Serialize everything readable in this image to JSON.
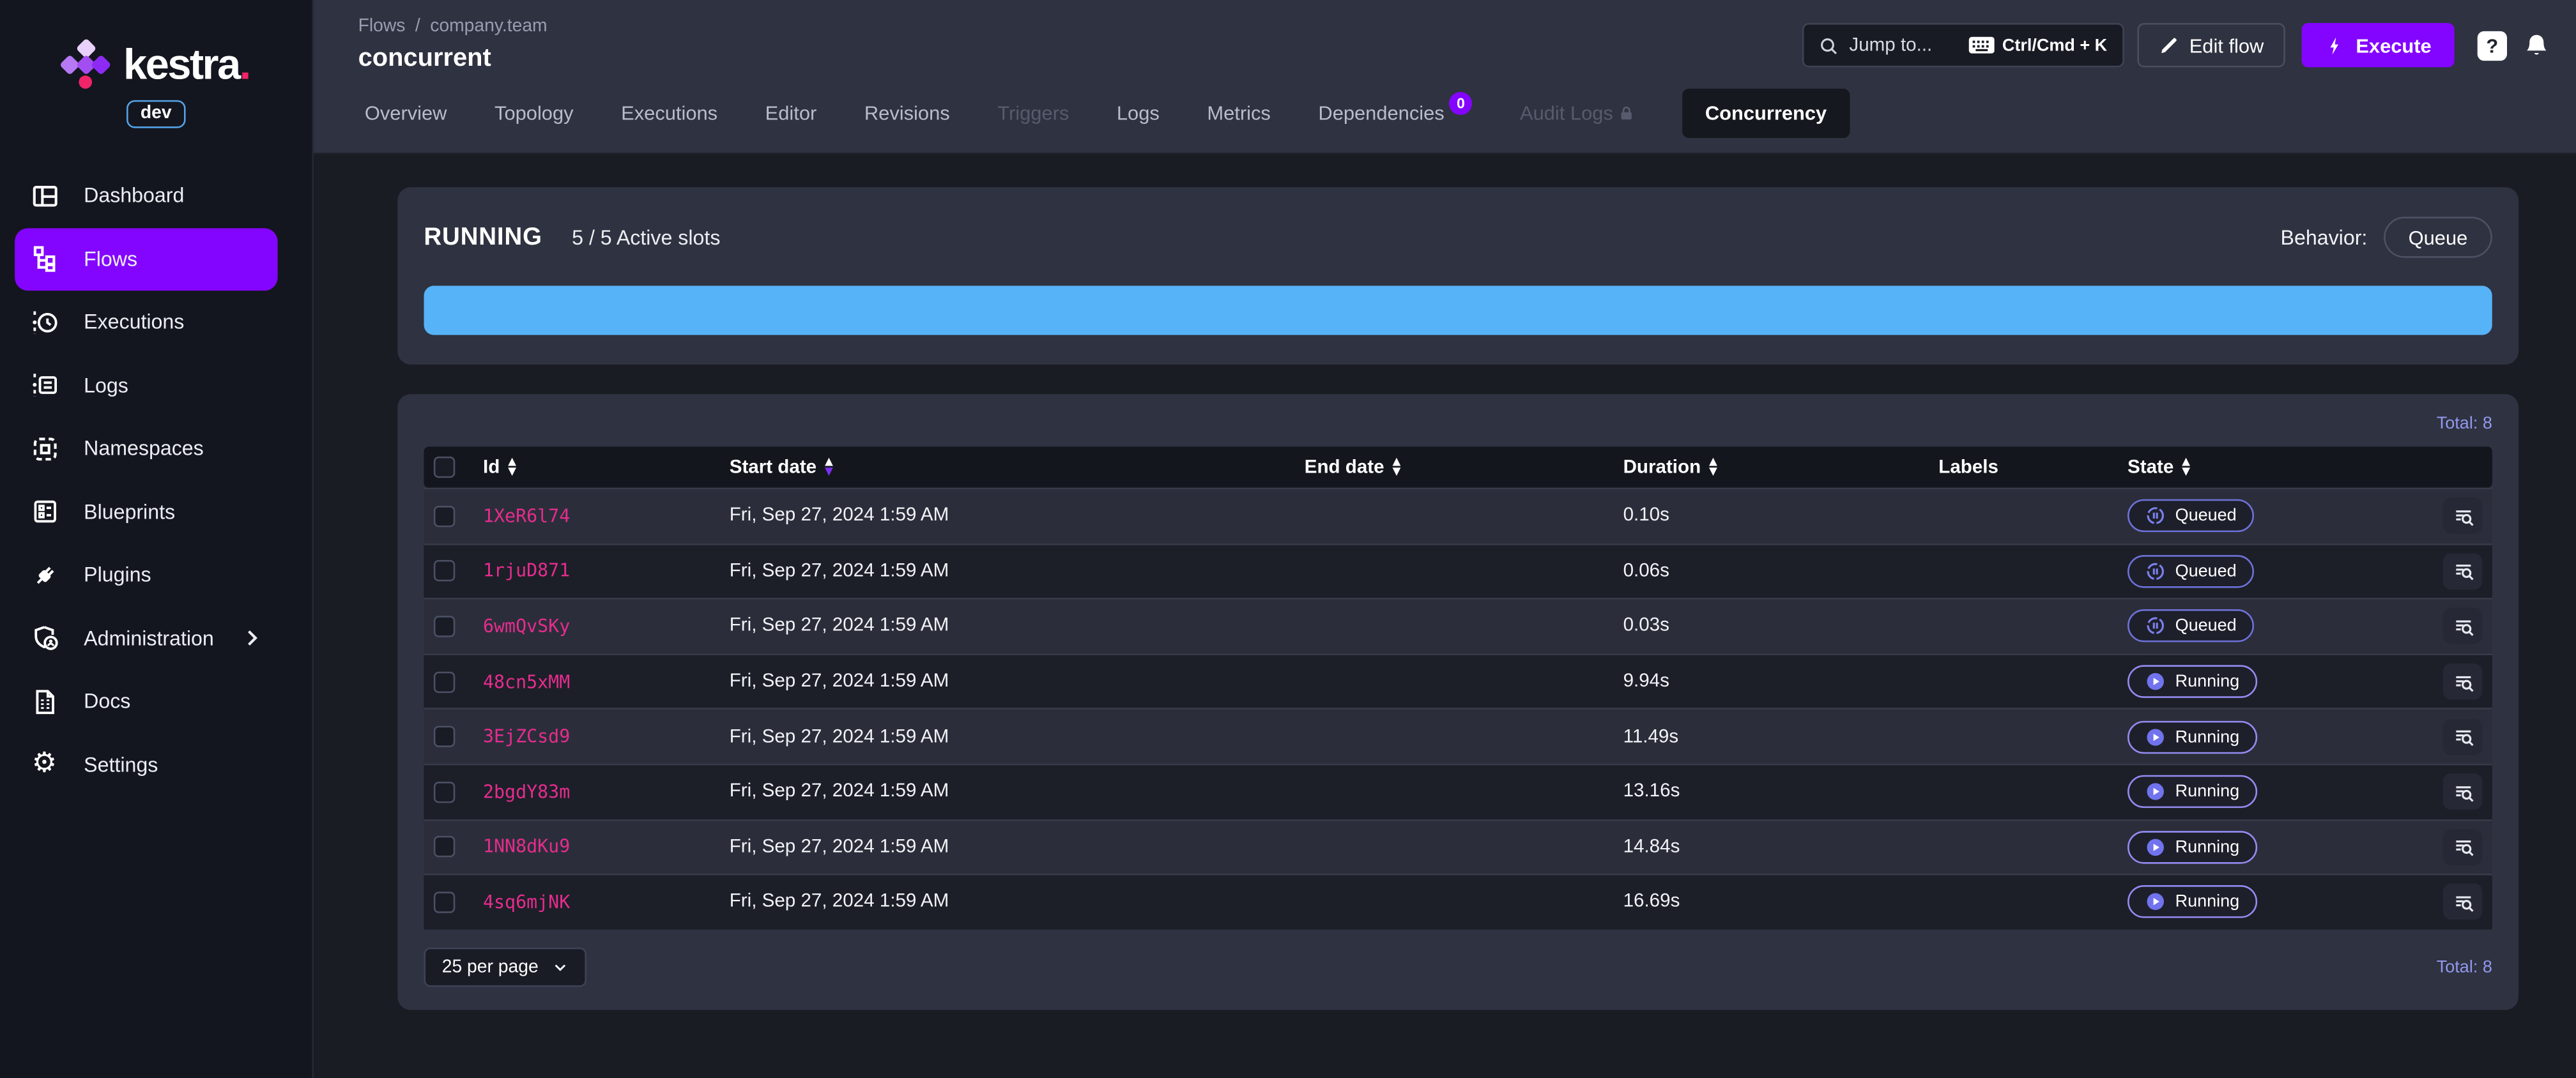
{
  "brand": {
    "name": "kestra",
    "env": "dev"
  },
  "breadcrumb": {
    "items": [
      "Flows",
      "company.team"
    ],
    "separator": "/"
  },
  "page": {
    "title": "concurrent"
  },
  "topbar": {
    "search": {
      "placeholder": "Jump to...",
      "shortcut": "Ctrl/Cmd + K"
    },
    "edit_flow_label": "Edit flow",
    "execute_label": "Execute",
    "help_label": "?"
  },
  "tabs": [
    {
      "label": "Overview"
    },
    {
      "label": "Topology"
    },
    {
      "label": "Executions"
    },
    {
      "label": "Editor"
    },
    {
      "label": "Revisions"
    },
    {
      "label": "Triggers",
      "disabled": true
    },
    {
      "label": "Logs"
    },
    {
      "label": "Metrics"
    },
    {
      "label": "Dependencies",
      "badge": "0"
    },
    {
      "label": "Audit Logs",
      "disabled": true,
      "lock": true
    },
    {
      "label": "Concurrency",
      "active": true
    }
  ],
  "sidebar": {
    "items": [
      {
        "label": "Dashboard",
        "icon": "dashboard-icon"
      },
      {
        "label": "Flows",
        "icon": "flows-icon",
        "active": true
      },
      {
        "label": "Executions",
        "icon": "executions-icon"
      },
      {
        "label": "Logs",
        "icon": "logs-icon"
      },
      {
        "label": "Namespaces",
        "icon": "namespaces-icon"
      },
      {
        "label": "Blueprints",
        "icon": "blueprints-icon"
      },
      {
        "label": "Plugins",
        "icon": "plugins-icon"
      },
      {
        "label": "Administration",
        "icon": "administration-icon",
        "chevron": true
      },
      {
        "label": "Docs",
        "icon": "docs-icon"
      },
      {
        "label": "Settings",
        "icon": "settings-icon"
      }
    ]
  },
  "concurrency": {
    "state_label": "RUNNING",
    "slots_label": "5 / 5 Active slots",
    "slots_active": 5,
    "slots_total": 5,
    "behavior_label": "Behavior:",
    "behavior_value": "Queue",
    "bar": {
      "fill_pct": 100,
      "color": "#57b3f8"
    }
  },
  "table": {
    "total_label": "Total: 8",
    "columns": [
      {
        "label": "Id",
        "sortable": true
      },
      {
        "label": "Start date",
        "sortable": true,
        "sorted": "desc"
      },
      {
        "label": "End date",
        "sortable": true
      },
      {
        "label": "Duration",
        "sortable": true
      },
      {
        "label": "Labels",
        "sortable": false
      },
      {
        "label": "State",
        "sortable": true
      }
    ],
    "rows": [
      {
        "id": "1XeR6l74",
        "start_date": "Fri, Sep 27, 2024 1:59 AM",
        "end_date": "",
        "duration": "0.10s",
        "labels": "",
        "state": "Queued"
      },
      {
        "id": "1rjuD871",
        "start_date": "Fri, Sep 27, 2024 1:59 AM",
        "end_date": "",
        "duration": "0.06s",
        "labels": "",
        "state": "Queued"
      },
      {
        "id": "6wmQvSKy",
        "start_date": "Fri, Sep 27, 2024 1:59 AM",
        "end_date": "",
        "duration": "0.03s",
        "labels": "",
        "state": "Queued"
      },
      {
        "id": "48cn5xMM",
        "start_date": "Fri, Sep 27, 2024 1:59 AM",
        "end_date": "",
        "duration": "9.94s",
        "labels": "",
        "state": "Running"
      },
      {
        "id": "3EjZCsd9",
        "start_date": "Fri, Sep 27, 2024 1:59 AM",
        "end_date": "",
        "duration": "11.49s",
        "labels": "",
        "state": "Running"
      },
      {
        "id": "2bgdY83m",
        "start_date": "Fri, Sep 27, 2024 1:59 AM",
        "end_date": "",
        "duration": "13.16s",
        "labels": "",
        "state": "Running"
      },
      {
        "id": "1NN8dKu9",
        "start_date": "Fri, Sep 27, 2024 1:59 AM",
        "end_date": "",
        "duration": "14.84s",
        "labels": "",
        "state": "Running"
      },
      {
        "id": "4sq6mjNK",
        "start_date": "Fri, Sep 27, 2024 1:59 AM",
        "end_date": "",
        "duration": "16.69s",
        "labels": "",
        "state": "Running"
      }
    ],
    "pagination": {
      "per_page": "25 per page",
      "total_label": "Total: 8"
    }
  },
  "colors": {
    "accent_purple": "#8405ff",
    "id_pink": "#e62c8e",
    "bar_blue": "#57b3f8",
    "total_periwinkle": "#9298ee",
    "state_border": "#7d81ef",
    "logo_pink": "#f02569",
    "env_badge_blue": "#53a3e8"
  }
}
